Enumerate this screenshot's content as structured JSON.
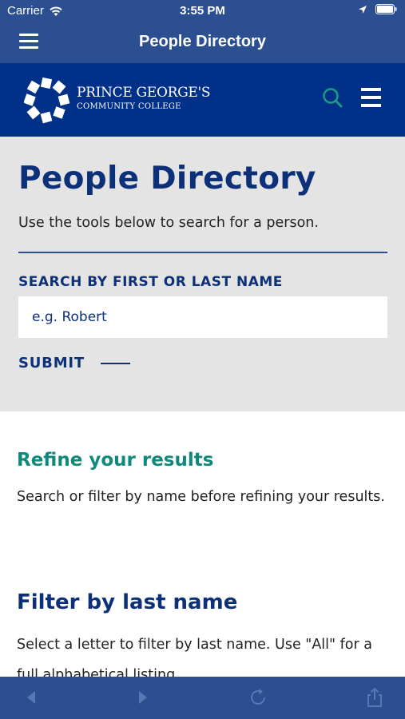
{
  "status_bar": {
    "carrier": "Carrier",
    "time": "3:55 PM",
    "icons": [
      "wifi-icon",
      "location-icon",
      "battery-icon"
    ]
  },
  "nav_bar": {
    "title": "People Directory",
    "menu_icon": "menu-icon"
  },
  "site_header": {
    "logo_line1": "PRINCE GEORGE'S",
    "logo_line2": "COMMUNITY COLLEGE",
    "search_icon": "search-icon",
    "menu_icon": "hamburger-icon"
  },
  "search_panel": {
    "heading": "People Directory",
    "intro": "Use the tools below to search for a person.",
    "field_label": "SEARCH BY FIRST OR LAST NAME",
    "placeholder": "e.g. Robert",
    "submit_label": "SUBMIT"
  },
  "content": {
    "refine_heading": "Refine your results",
    "refine_text": "Search or filter by name before refining your results.",
    "filter_heading": "Filter by last name",
    "filter_text": "Select a letter to filter by last name. Use \"All\" for a full alphabetical listing."
  },
  "toolbar": {
    "buttons": [
      "back-icon",
      "forward-icon",
      "refresh-icon",
      "share-icon"
    ]
  },
  "colors": {
    "nav_blue": "#2c4f92",
    "header_navy": "#003087",
    "heading_navy": "#0d3179",
    "accent_teal": "#0f8a7a",
    "panel_gray": "#e4e4e4"
  }
}
